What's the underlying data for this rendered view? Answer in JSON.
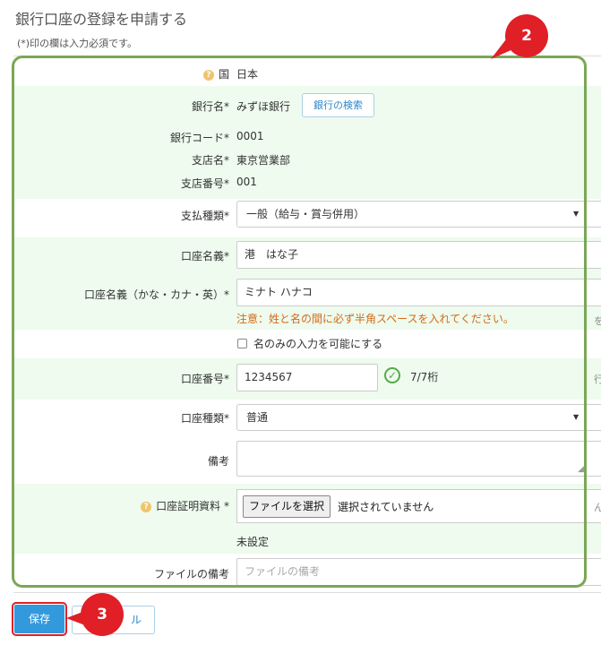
{
  "page": {
    "title": "銀行口座の登録を申請する",
    "required_note": "(*)印の欄は入力必須です。"
  },
  "form": {
    "country": {
      "label": "国",
      "value": "日本"
    },
    "bank_name": {
      "label": "銀行名*",
      "value": "みずほ銀行",
      "search_button": "銀行の検索"
    },
    "bank_code": {
      "label": "銀行コード*",
      "value": "0001"
    },
    "branch_name": {
      "label": "支店名*",
      "value": "東京営業部"
    },
    "branch_number": {
      "label": "支店番号*",
      "value": "001"
    },
    "payment_type": {
      "label": "支払種類*",
      "value": "一般（給与・賞与併用）"
    },
    "account_holder": {
      "label": "口座名義*",
      "value": "港　はな子"
    },
    "account_holder_kana": {
      "label": "口座名義（かな・カナ・英）*",
      "value": "ミナト ハナコ",
      "warning": "注意：姓と名の間に必ず半角スペースを入れてください。"
    },
    "name_only": {
      "label": "名のみの入力を可能にする",
      "checked": false
    },
    "account_number": {
      "label": "口座番号*",
      "value": "1234567",
      "digits": "7/7桁"
    },
    "account_type": {
      "label": "口座種類*",
      "value": "普通"
    },
    "remarks": {
      "label": "備考",
      "value": ""
    },
    "proof_document": {
      "label": "口座証明資料 *",
      "choose_button": "ファイルを選択",
      "file_status": "選択されていません",
      "state": "未設定"
    },
    "file_remarks": {
      "label": "ファイルの備考",
      "placeholder": "ファイルの備考"
    }
  },
  "edge_chars": {
    "r1": "を",
    "r2": "行",
    "r3": "ん"
  },
  "buttons": {
    "save": "保存",
    "cancel": "ル"
  },
  "annotations": {
    "marker2": "2",
    "marker3": "3",
    "color": "#e01f26",
    "outline_color": "#7aa755"
  },
  "colors": {
    "accent": "#3399dd",
    "row_tint": "#eefbee",
    "warning": "#d46a17",
    "ok": "#57a84a"
  }
}
